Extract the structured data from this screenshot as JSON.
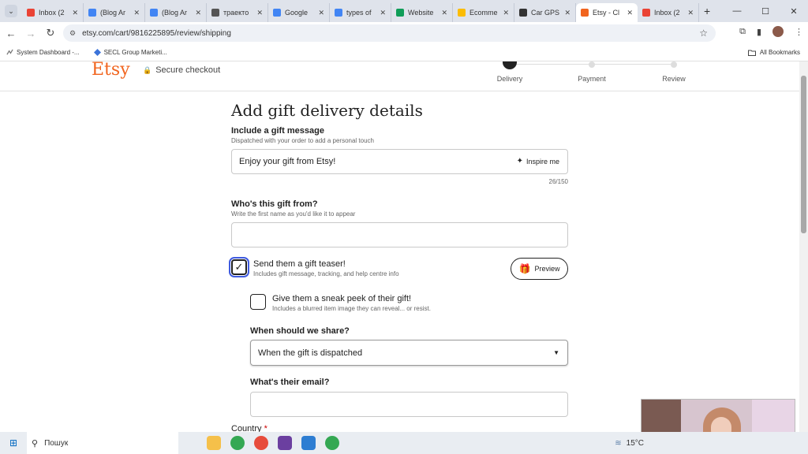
{
  "browser": {
    "tabs": [
      {
        "label": "Inbox (2",
        "icon": "gmail-icon",
        "color": "#ea4335",
        "active": false
      },
      {
        "label": "(Blog Ar",
        "icon": "docs-icon",
        "color": "#4285f4",
        "active": false
      },
      {
        "label": "(Blog Ar",
        "icon": "docs-icon",
        "color": "#4285f4",
        "active": false
      },
      {
        "label": "траекто",
        "icon": "web-icon",
        "color": "#555555",
        "active": false
      },
      {
        "label": "Google",
        "icon": "translate-icon",
        "color": "#4285f4",
        "active": false
      },
      {
        "label": "types of",
        "icon": "google-icon",
        "color": "#4285f4",
        "active": false
      },
      {
        "label": "Website",
        "icon": "sheets-icon",
        "color": "#0f9d58",
        "active": false
      },
      {
        "label": "Ecomme",
        "icon": "drive-icon",
        "color": "#fbbc04",
        "active": false
      },
      {
        "label": "Car GPS",
        "icon": "car-icon",
        "color": "#333333",
        "active": false
      },
      {
        "label": "Etsy - Cl",
        "icon": "etsy-icon",
        "color": "#f1641e",
        "active": true
      },
      {
        "label": "Inbox (2",
        "icon": "gmail-icon",
        "color": "#ea4335",
        "active": false
      }
    ],
    "url": "etsy.com/cart/9816225895/review/shipping",
    "bookmarks": [
      {
        "label": "System Dashboard -...",
        "color": "#777777"
      },
      {
        "label": "SECL Group Marketi...",
        "color": "#3b73d9"
      }
    ],
    "all_bookmarks": "All Bookmarks"
  },
  "header": {
    "logo": "Etsy",
    "secure": "Secure checkout",
    "steps": [
      "Delivery",
      "Payment",
      "Review"
    ]
  },
  "form": {
    "title": "Add gift delivery details",
    "gift_message_label": "Include a gift message",
    "gift_message_sub": "Dispatched with your order to add a personal touch",
    "gift_message_value": "Enjoy your gift from Etsy!",
    "inspire_label": "Inspire me",
    "counter": "26/150",
    "from_label": "Who's this gift from?",
    "from_sub": "Write the first name as you'd like it to appear",
    "teaser_title": "Send them a gift teaser!",
    "teaser_sub": "Includes gift message, tracking, and help centre info",
    "preview_label": "Preview",
    "peek_title": "Give them a sneak peek of their gift!",
    "peek_sub": "Includes a blurred item image they can reveal... or resist.",
    "share_label": "When should we share?",
    "share_value": "When the gift is dispatched",
    "email_label": "What's their email?",
    "country_label": "Country",
    "required_mark": "*"
  },
  "taskbar": {
    "search_placeholder": "Пошук",
    "temperature": "15°C"
  },
  "colors": {
    "etsy_orange": "#f1641e",
    "focus_blue": "#3f5be0"
  }
}
